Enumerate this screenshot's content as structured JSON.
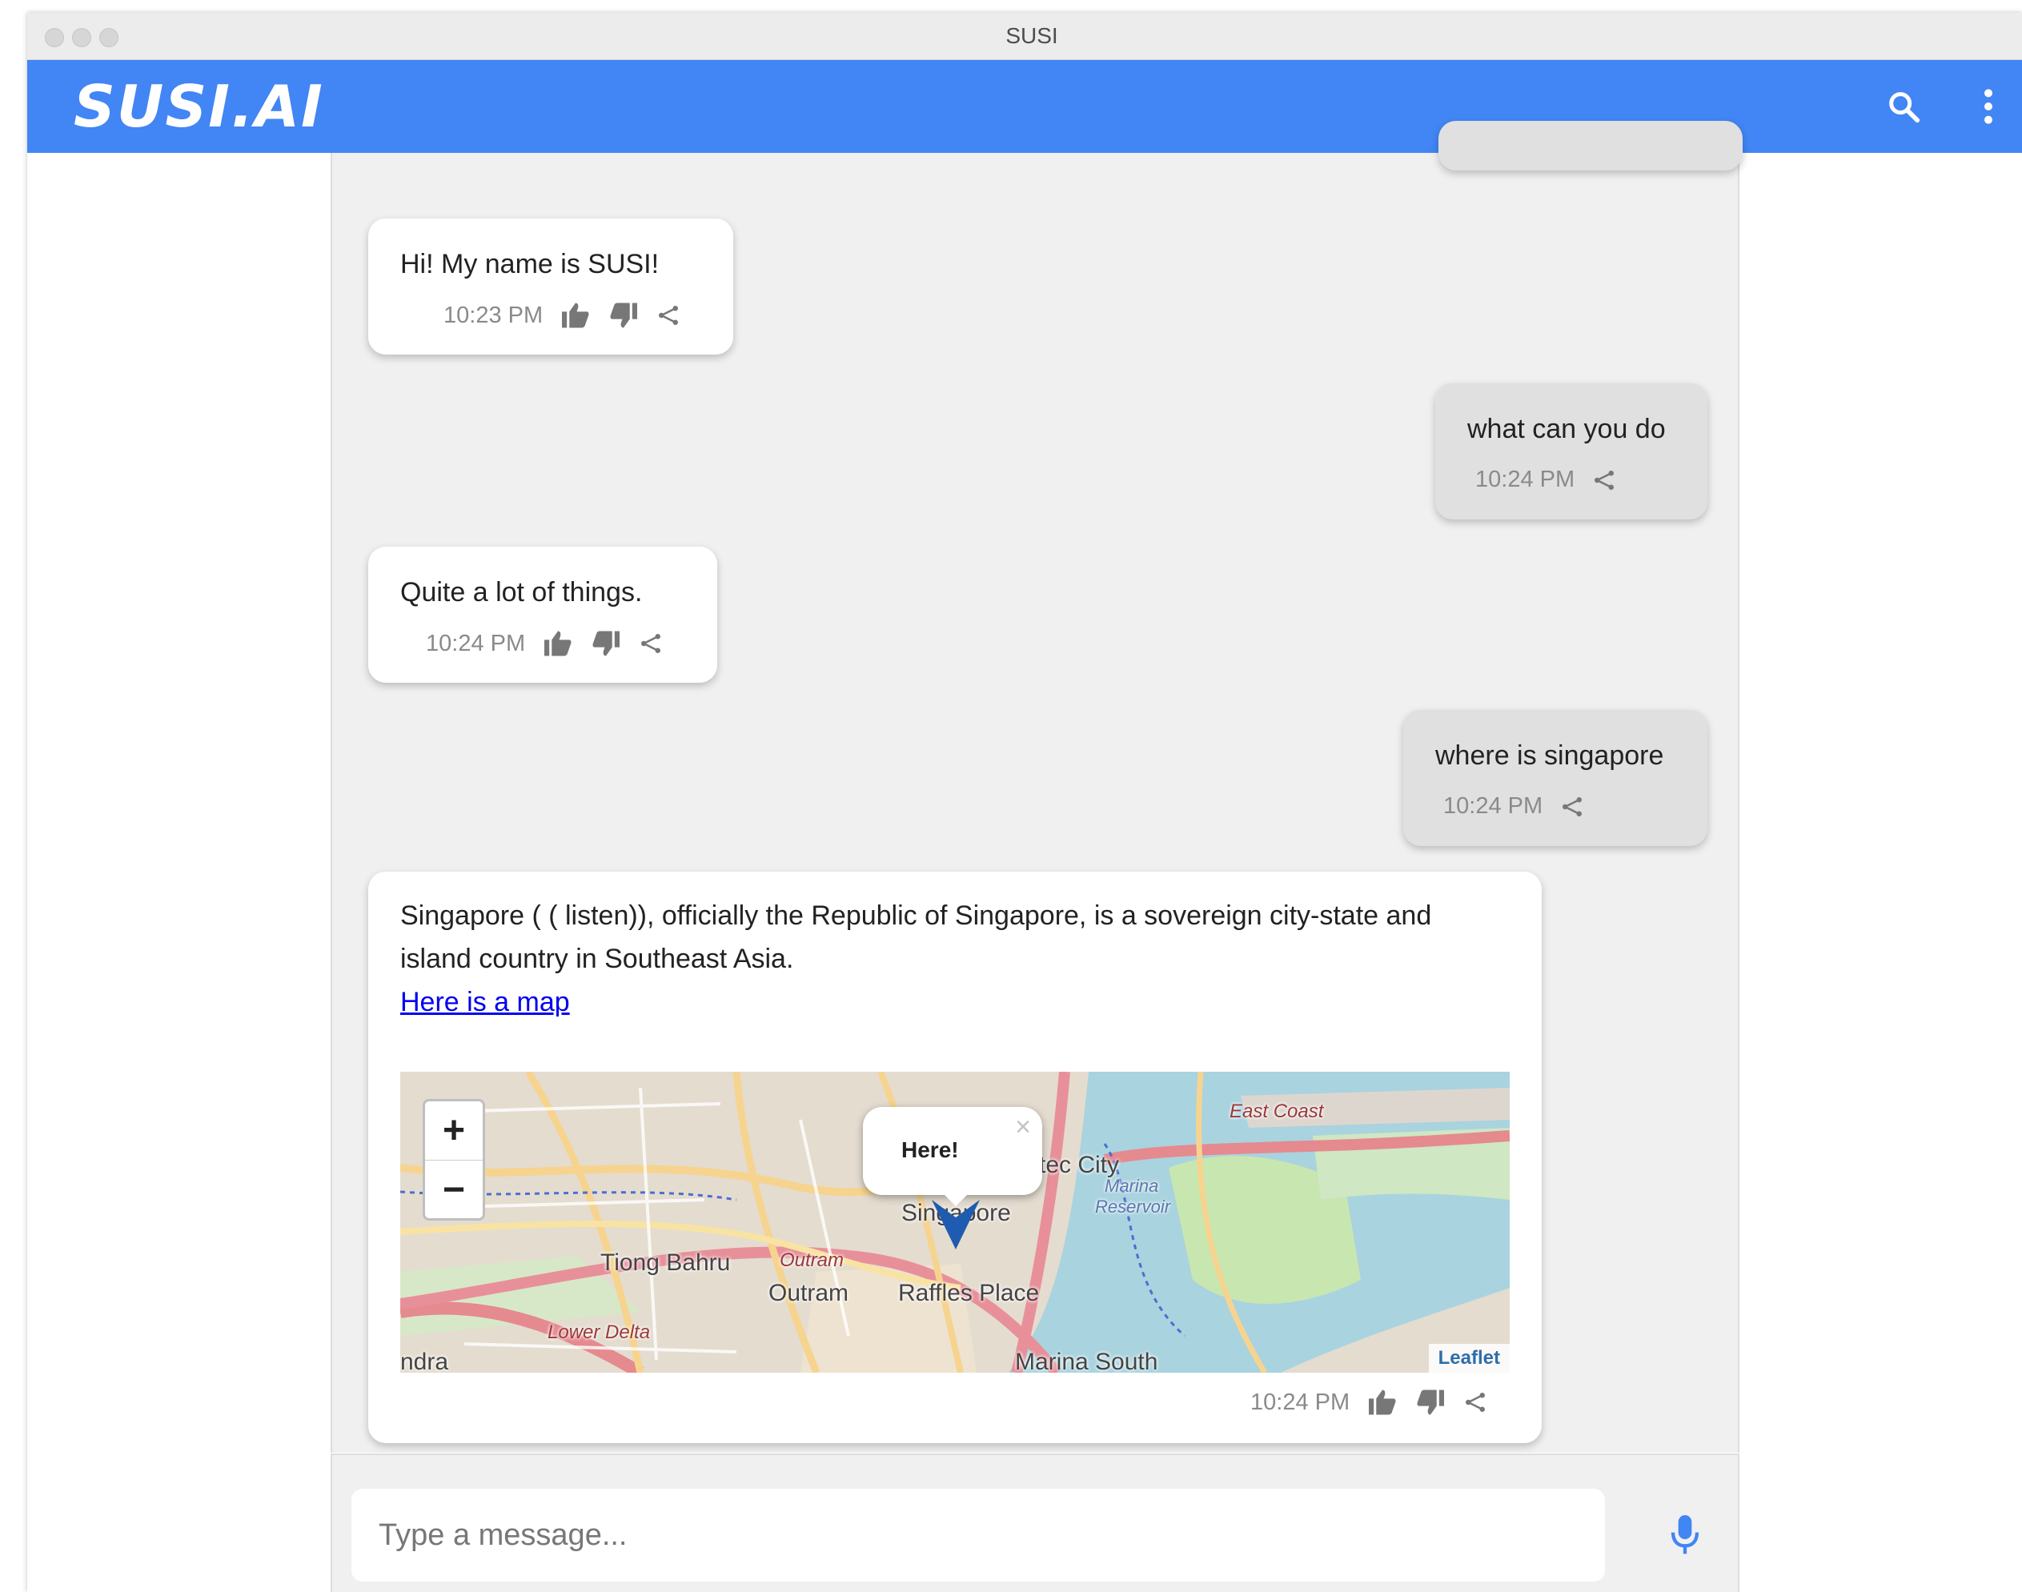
{
  "window": {
    "title": "SUSI"
  },
  "appbar": {
    "logo": "SUSI.AI",
    "search_icon": "search-icon",
    "more_icon": "more-vert-icon"
  },
  "colors": {
    "appbar": "#4285f4",
    "chat_bg": "#f0f0f0",
    "bot_bubble": "#ffffff",
    "user_bubble": "#e0e0e0",
    "link": "#0000ee",
    "mic": "#4285f4"
  },
  "messages": [
    {
      "sender": "susi",
      "text": "Hi! My name is SUSI!",
      "time": "10:23 PM"
    },
    {
      "sender": "user",
      "text": "what can you do",
      "time": "10:24 PM"
    },
    {
      "sender": "susi",
      "text": "Quite a lot of things.",
      "time": "10:24 PM"
    },
    {
      "sender": "user",
      "text": "where is singapore",
      "time": "10:24 PM"
    },
    {
      "sender": "susi",
      "text_line1": "Singapore ( ( listen)), officially the Republic of Singapore, is a sovereign city-state and",
      "text_line2": "island country in Southeast Asia.",
      "link": "Here is a map",
      "time": "10:24 PM"
    }
  ],
  "map": {
    "zoom_in": "+",
    "zoom_out": "−",
    "popup": {
      "text": "Here!",
      "close": "×"
    },
    "attribution": "Leaflet",
    "labels": {
      "tiong_bahru": "Tiong Bahru",
      "outram": "Outram",
      "outram_station": "Outram",
      "raffles_place": "Raffles Place",
      "singapore": "Singapore",
      "city": "tec City",
      "marina_reservoir": "Marina",
      "reservoir": "Reservoir",
      "east_coast": "East Coast",
      "lower_delta": "Lower Delta",
      "marina_south": "Marina South",
      "edge_left": "ndra"
    }
  },
  "composer": {
    "placeholder": "Type a message...",
    "mic_icon": "mic-icon"
  }
}
